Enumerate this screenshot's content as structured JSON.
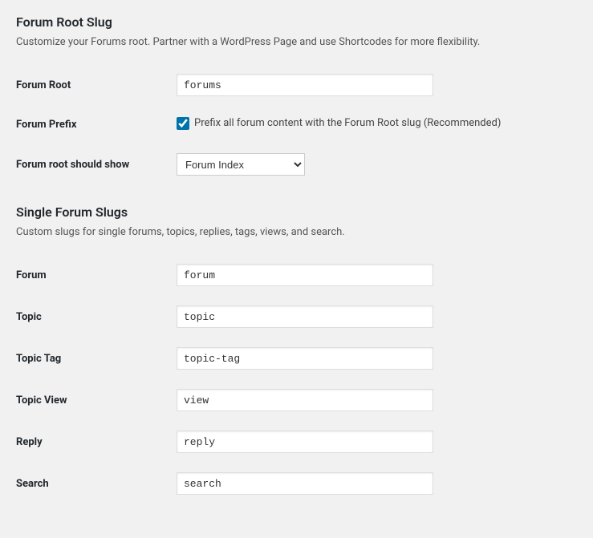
{
  "section1": {
    "title": "Forum Root Slug",
    "desc": "Customize your Forums root. Partner with a WordPress Page and use Shortcodes for more flexibility.",
    "forum_root": {
      "label": "Forum Root",
      "value": "forums"
    },
    "forum_prefix": {
      "label": "Forum Prefix",
      "checkbox_label": "Prefix all forum content with the Forum Root slug (Recommended)",
      "checked": true
    },
    "forum_root_show": {
      "label": "Forum root should show",
      "selected": "Forum Index"
    }
  },
  "section2": {
    "title": "Single Forum Slugs",
    "desc": "Custom slugs for single forums, topics, replies, tags, views, and search.",
    "forum": {
      "label": "Forum",
      "value": "forum"
    },
    "topic": {
      "label": "Topic",
      "value": "topic"
    },
    "topic_tag": {
      "label": "Topic Tag",
      "value": "topic-tag"
    },
    "topic_view": {
      "label": "Topic View",
      "value": "view"
    },
    "reply": {
      "label": "Reply",
      "value": "reply"
    },
    "search": {
      "label": "Search",
      "value": "search"
    }
  }
}
